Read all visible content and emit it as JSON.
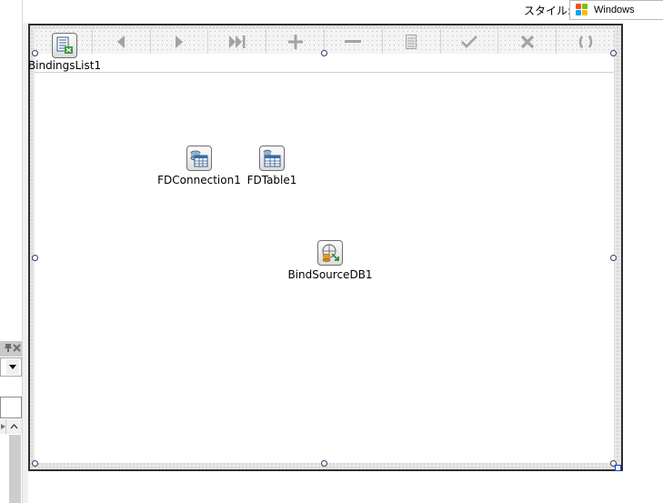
{
  "style_selector": {
    "label": "スタイル:",
    "value": "Windows",
    "icon": "windows-flag-icon"
  },
  "navigator": {
    "buttons": [
      {
        "name": "first",
        "icon": "bindings-list-icon"
      },
      {
        "name": "prior",
        "icon": "triangle-left-icon"
      },
      {
        "name": "next",
        "icon": "triangle-right-icon"
      },
      {
        "name": "last",
        "icon": "skip-last-icon"
      },
      {
        "name": "insert",
        "icon": "plus-icon"
      },
      {
        "name": "delete",
        "icon": "minus-icon"
      },
      {
        "name": "edit",
        "icon": "document-icon"
      },
      {
        "name": "post",
        "icon": "checkmark-icon"
      },
      {
        "name": "cancel",
        "icon": "x-icon"
      },
      {
        "name": "refresh",
        "icon": "refresh-icon"
      }
    ]
  },
  "components": [
    {
      "id": "bindings-list",
      "label": "BindingsList1",
      "icon": "bindings-list-icon"
    },
    {
      "id": "fd-connection",
      "label": "FDConnection1",
      "icon": "fd-connection-icon"
    },
    {
      "id": "fd-table",
      "label": "FDTable1",
      "icon": "fd-table-icon"
    },
    {
      "id": "bind-source",
      "label": "BindSourceDB1",
      "icon": "bind-source-icon"
    }
  ],
  "colors": {
    "form_border": "#2f2f2f",
    "selection_handle": "#333a66",
    "canvas": "#ffffff",
    "nav_glyph": "#a3a3a3"
  }
}
